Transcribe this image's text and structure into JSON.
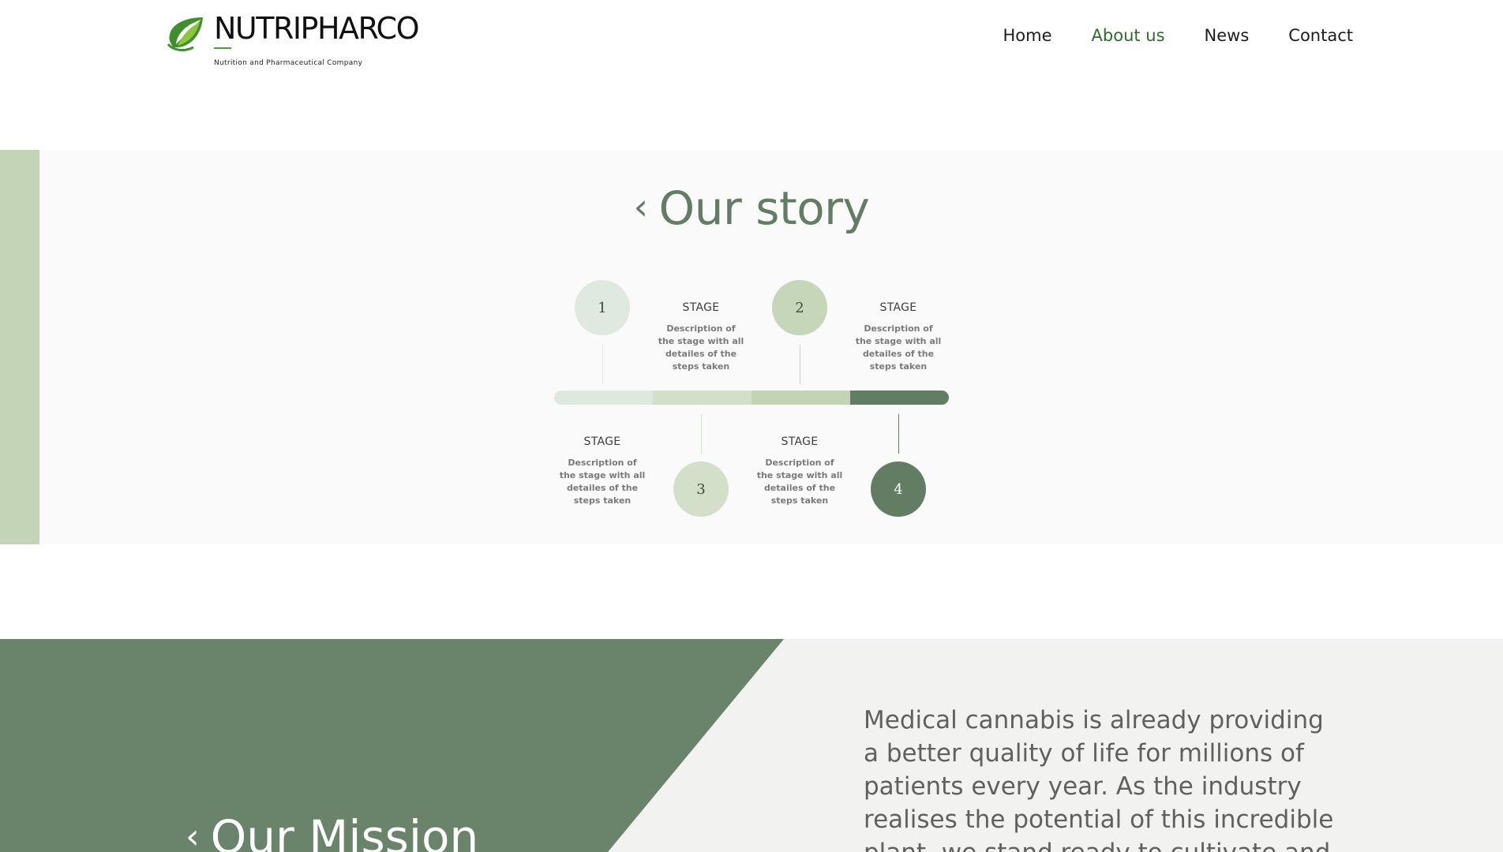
{
  "header": {
    "logo": {
      "name": "NUTRIPHARCO",
      "tagline": "Nutrition and Pharmaceutical Company",
      "leaf_colors": [
        "#3f8f2c",
        "#8cc63e"
      ]
    },
    "nav": [
      {
        "label": "Home",
        "active": false
      },
      {
        "label": "About us",
        "active": true
      },
      {
        "label": "News",
        "active": false
      },
      {
        "label": "Contact",
        "active": false
      }
    ]
  },
  "story": {
    "title": "Our story",
    "chevron": "‹",
    "track_colors": [
      "#dde9df",
      "#d3dfc9",
      "#c3d4b6",
      "#617d63"
    ],
    "stages": [
      {
        "number": "1",
        "stage_label": "STAGE",
        "description": "Description of the stage with all detailes of the steps taken",
        "circle_color": "#dfe9e0",
        "text_color": "#3c4a3c"
      },
      {
        "number": "2",
        "stage_label": "STAGE",
        "description": "Description of the stage with all detailes of the steps taken",
        "circle_color": "#c5d6b9",
        "text_color": "#3c4a3c"
      },
      {
        "number": "3",
        "stage_label": "STAGE",
        "description": "Description of the stage with all detailes of the steps taken",
        "circle_color": "#d3dfc9",
        "text_color": "#3c4a3c"
      },
      {
        "number": "4",
        "stage_label": "STAGE",
        "description": "Description of the stage with all detailes of the steps taken",
        "circle_color": "#627d63",
        "text_color": "#ffffff"
      }
    ]
  },
  "mission": {
    "title": "Our Mission",
    "chevron": "‹",
    "text": "Medical cannabis is already providing a better quality of life for millions of patients every year. As the industry realises the potential of this incredible plant, we stand ready to cultivate and",
    "shape_color": "#6a846b",
    "background_color": "#f2f3f1"
  }
}
